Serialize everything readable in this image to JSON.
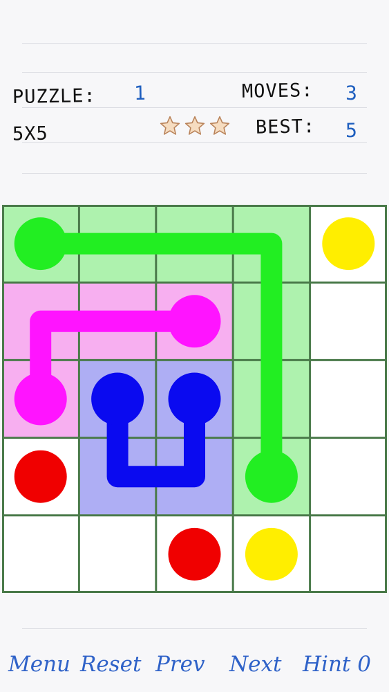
{
  "header": {
    "puzzle_label": "PUZZLE:",
    "puzzle_value": "1",
    "moves_label": "MOVES:",
    "moves_value": "3",
    "size_label": "5X5",
    "best_label": "BEST:",
    "best_value": "5",
    "stars": 3
  },
  "board": {
    "rows": 5,
    "cols": 5,
    "grid_line_color": "#4a7a4a",
    "cell_bg": "#ffffff",
    "colors": {
      "green": "#22ee22",
      "magenta": "#ff14ff",
      "blue": "#0a0af0",
      "red": "#f00000",
      "yellow": "#ffee00"
    },
    "fills": {
      "green": "#aef2ae",
      "magenta": "#f7aff0",
      "blue": "#aeaef4"
    },
    "endpoints": [
      {
        "color": "green",
        "r": 0,
        "c": 0
      },
      {
        "color": "green",
        "r": 3,
        "c": 3
      },
      {
        "color": "yellow",
        "r": 0,
        "c": 4
      },
      {
        "color": "yellow",
        "r": 4,
        "c": 3
      },
      {
        "color": "magenta",
        "r": 1,
        "c": 2
      },
      {
        "color": "magenta",
        "r": 2,
        "c": 0
      },
      {
        "color": "blue",
        "r": 2,
        "c": 1
      },
      {
        "color": "blue",
        "r": 2,
        "c": 2
      },
      {
        "color": "red",
        "r": 3,
        "c": 0
      },
      {
        "color": "red",
        "r": 4,
        "c": 2
      }
    ],
    "paths": [
      {
        "color": "green",
        "cells": [
          [
            0,
            0
          ],
          [
            0,
            1
          ],
          [
            0,
            2
          ],
          [
            0,
            3
          ],
          [
            1,
            3
          ],
          [
            2,
            3
          ],
          [
            3,
            3
          ]
        ]
      },
      {
        "color": "magenta",
        "cells": [
          [
            1,
            2
          ],
          [
            1,
            1
          ],
          [
            1,
            0
          ],
          [
            2,
            0
          ]
        ]
      },
      {
        "color": "blue",
        "cells": [
          [
            2,
            1
          ],
          [
            3,
            1
          ],
          [
            3,
            2
          ],
          [
            2,
            2
          ]
        ]
      }
    ]
  },
  "footer": {
    "menu": "Menu",
    "reset": "Reset",
    "prev": "Prev",
    "next": "Next",
    "hint": "Hint 0"
  }
}
